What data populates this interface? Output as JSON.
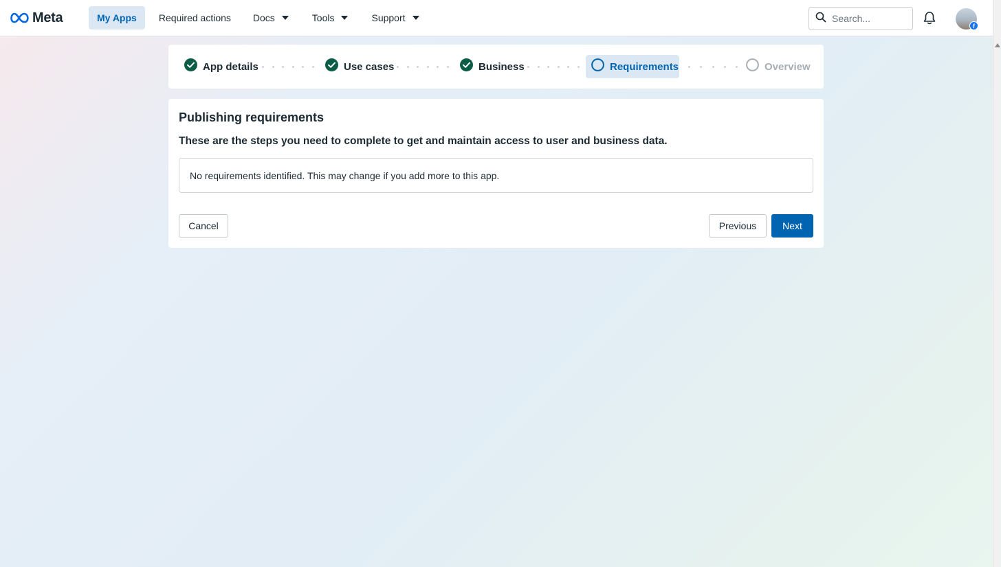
{
  "brand": {
    "name": "Meta"
  },
  "nav": {
    "items": [
      {
        "label": "My Apps",
        "active": true
      },
      {
        "label": "Required actions",
        "active": false
      },
      {
        "label": "Docs",
        "dropdown": true
      },
      {
        "label": "Tools",
        "dropdown": true
      },
      {
        "label": "Support",
        "dropdown": true
      }
    ]
  },
  "search": {
    "placeholder": "Search..."
  },
  "stepper": {
    "steps": [
      {
        "label": "App details",
        "state": "complete"
      },
      {
        "label": "Use cases",
        "state": "complete"
      },
      {
        "label": "Business",
        "state": "complete"
      },
      {
        "label": "Requirements",
        "state": "current"
      },
      {
        "label": "Overview",
        "state": "upcoming"
      }
    ]
  },
  "card": {
    "title": "Publishing requirements",
    "subtitle": "These are the steps you need to complete to get and maintain access to user and business data.",
    "notice": "No requirements identified. This may change if you add more to this app."
  },
  "actions": {
    "cancel": "Cancel",
    "previous": "Previous",
    "next": "Next"
  },
  "colors": {
    "accent": "#0064b0",
    "complete": "#0b5d45",
    "current_bg": "#dbe8f3",
    "upcoming": "#a6aeb5"
  }
}
